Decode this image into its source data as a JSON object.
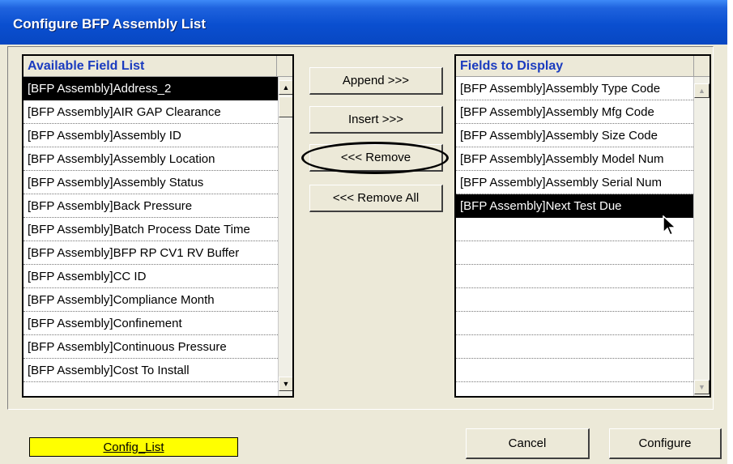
{
  "window": {
    "title": "Configure BFP Assembly List"
  },
  "available": {
    "header": "Available Field List",
    "items": [
      "[BFP Assembly]Address_2",
      "[BFP Assembly]AIR GAP Clearance",
      "[BFP Assembly]Assembly ID",
      "[BFP Assembly]Assembly Location",
      "[BFP Assembly]Assembly Status",
      "[BFP Assembly]Back Pressure",
      "[BFP Assembly]Batch Process Date Time",
      "[BFP Assembly]BFP RP CV1 RV Buffer",
      "[BFP Assembly]CC ID",
      "[BFP Assembly]Compliance Month",
      "[BFP Assembly]Confinement",
      "[BFP Assembly]Continuous Pressure",
      "[BFP Assembly]Cost To Install"
    ],
    "selected_index": 0
  },
  "buttons": {
    "append": "Append >>>",
    "insert": "Insert >>>",
    "remove": "<<< Remove",
    "remove_all": "<<< Remove All",
    "cancel": "Cancel",
    "configure": "Configure"
  },
  "display": {
    "header": "Fields to Display",
    "items": [
      "[BFP Assembly]Assembly Type Code",
      "[BFP Assembly]Assembly Mfg Code",
      "[BFP Assembly]Assembly Size Code",
      "[BFP Assembly]Assembly Model Num",
      "[BFP Assembly]Assembly Serial Num",
      "[BFP Assembly]Next Test Due",
      "",
      "",
      "",
      "",
      "",
      "",
      ""
    ],
    "selected_index": 5
  },
  "config_list": {
    "label": "Config_List",
    "color": "#ffff00"
  },
  "colors": {
    "title_bar": "#0a4fd0",
    "header_text": "#1a3bbf",
    "selection": "#000000"
  },
  "icons": {
    "scroll_up": "triangle-up",
    "scroll_down": "triangle-down",
    "cursor": "arrow-pointer"
  }
}
